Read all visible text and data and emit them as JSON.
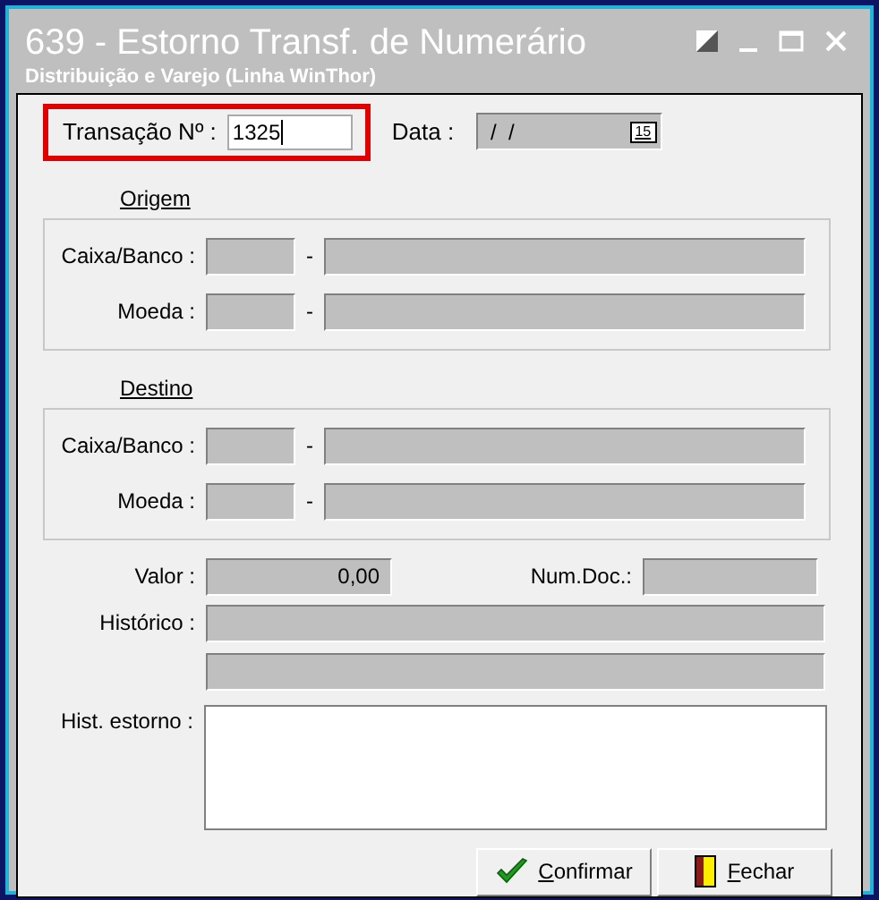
{
  "window": {
    "title": "639 - Estorno Transf. de Numerário",
    "subtitle": "Distribuição e Varejo (Linha WinThor)"
  },
  "transacao": {
    "label": "Transação Nº :",
    "value": "1325",
    "highlighted": true
  },
  "data": {
    "label": "Data :",
    "value": " /  /",
    "calendar": "15"
  },
  "groups": [
    {
      "title": "Origem",
      "rows": [
        {
          "label": "Caixa/Banco :",
          "separator": "-"
        },
        {
          "label": "Moeda :",
          "separator": "-"
        }
      ]
    },
    {
      "title": "Destino",
      "rows": [
        {
          "label": "Caixa/Banco :",
          "separator": "-"
        },
        {
          "label": "Moeda :",
          "separator": "-"
        }
      ]
    }
  ],
  "valor": {
    "label": "Valor :",
    "value": "0,00"
  },
  "num_doc": {
    "label": "Num.Doc.:"
  },
  "historico": {
    "label": "Histórico :"
  },
  "hist_estorno": {
    "label": "Hist. estorno :"
  },
  "buttons": [
    {
      "label": "Confirmar",
      "kind": "confirm"
    },
    {
      "label": "Fechar",
      "kind": "close"
    }
  ]
}
